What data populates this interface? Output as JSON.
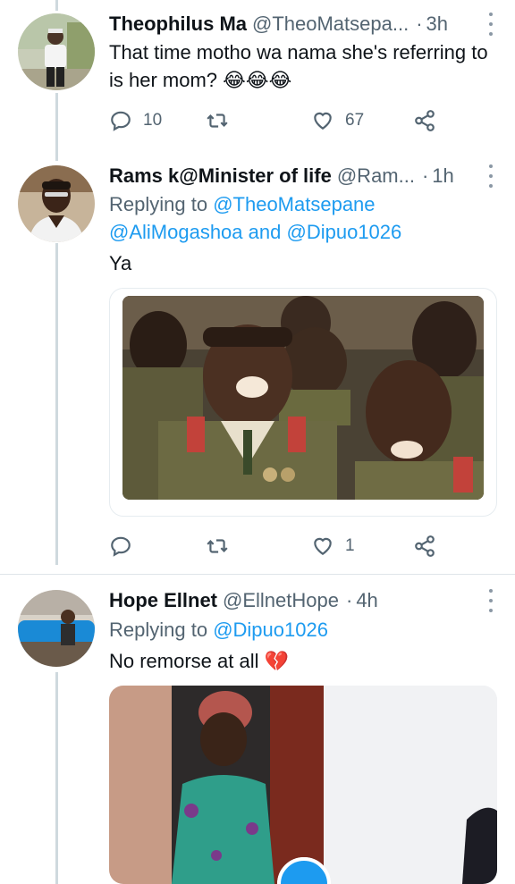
{
  "tweets": [
    {
      "name": "Theophilus Ma",
      "handle": "@TheoMatsepa...",
      "time": "3h",
      "text": "That time motho wa nama she's referring to is her mom?",
      "emoji": "😂😂😂",
      "reply_count": "10",
      "like_count": "67"
    },
    {
      "name": "Rams k@Minister of life",
      "handle": "@Ram...",
      "time": "1h",
      "replying_label": "Replying to",
      "replying_to_1": "@TheoMatsepane",
      "replying_to_2": "@AliMogashoa",
      "replying_and": "and",
      "replying_to_3": "@Dipuo1026",
      "text": "Ya",
      "like_count": "1"
    },
    {
      "name": "Hope Ellnet",
      "handle": "@EllnetHope",
      "time": "4h",
      "replying_label": "Replying to",
      "replying_to_1": "@Dipuo1026",
      "text": "No remorse at all",
      "emoji": "💔"
    }
  ],
  "icons": {
    "reply": "reply-icon",
    "retweet": "retweet-icon",
    "like": "heart-icon",
    "share": "share-icon",
    "more": "more-icon",
    "play": "play-icon"
  },
  "colors": {
    "link": "#1d9bf0",
    "muted": "#536471",
    "text": "#0f1419"
  }
}
